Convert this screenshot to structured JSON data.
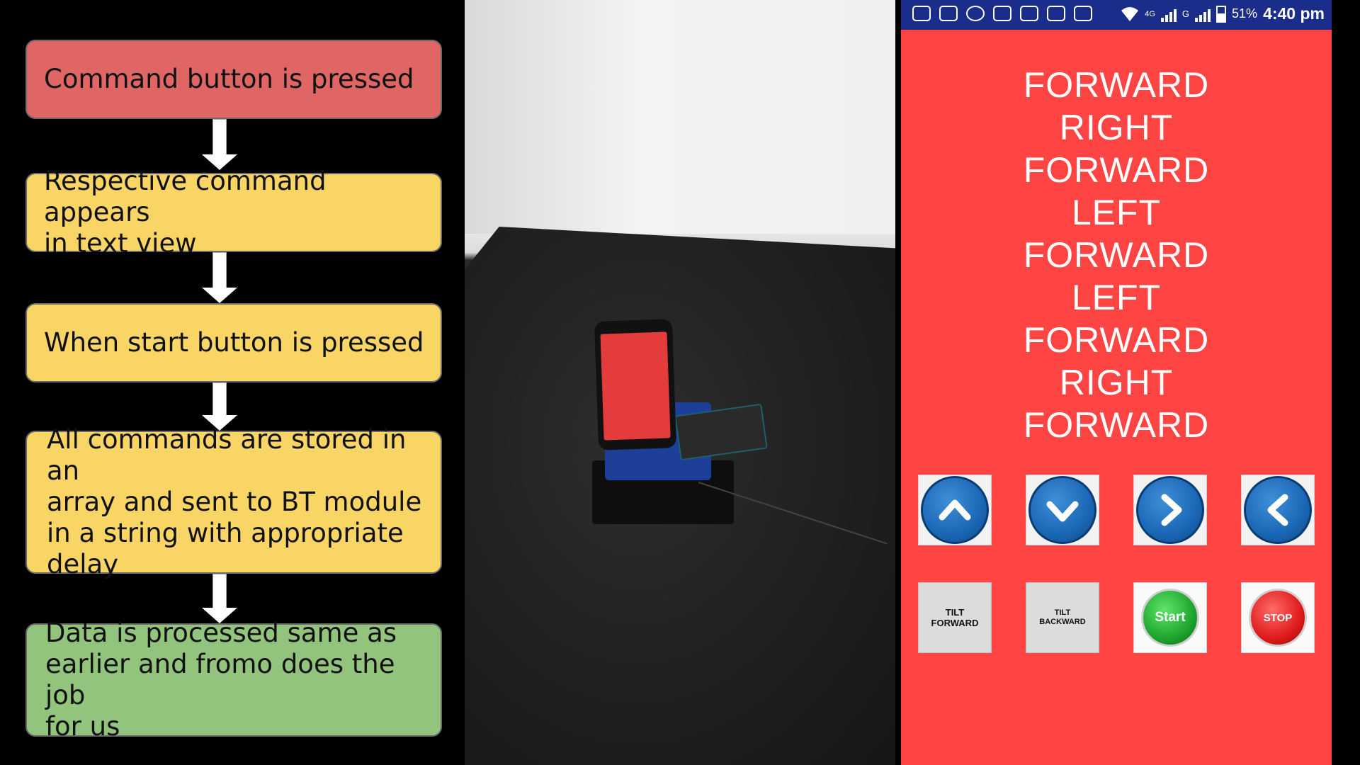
{
  "flowchart": {
    "steps": [
      {
        "lines": [
          "Command button is pressed"
        ],
        "color": "#e06666"
      },
      {
        "lines": [
          "Respective command appears",
          "in text view"
        ],
        "color": "#f9d566"
      },
      {
        "lines": [
          "When start button is pressed"
        ],
        "color": "#f9d566"
      },
      {
        "lines": [
          "All commands are stored in an",
          "array and sent to BT module",
          "in a string with appropriate",
          "delay"
        ],
        "color": "#f9d566"
      },
      {
        "lines": [
          "Data is processed same as",
          "earlier and fromo does the job",
          "for us"
        ],
        "color": "#93c47d"
      }
    ]
  },
  "phone_app": {
    "status_bar": {
      "network_label": "4G",
      "network_label_2": "G",
      "battery": "51%",
      "time": "4:40 pm",
      "battery_level": 0.51,
      "icons": [
        "message-icon",
        "video-icon",
        "whatsapp-icon",
        "app-grid-icon",
        "app-grid-icon",
        "cast-icon",
        "vibrate-icon",
        "wifi-icon",
        "signal-icon",
        "battery-icon"
      ]
    },
    "command_list": [
      "FORWARD",
      "RIGHT",
      "FORWARD",
      "LEFT",
      "FORWARD",
      "LEFT",
      "FORWARD",
      "RIGHT",
      "FORWARD"
    ],
    "buttons": {
      "tilt_forward": "TILT\nFORWARD",
      "tilt_backward": "TILT\nBACKWARD",
      "start": "Start",
      "stop": "STOP"
    },
    "colors": {
      "background": "#ff4444",
      "status_bar": "#1b2d8b",
      "arrow_button": "#1d6ab8"
    }
  }
}
